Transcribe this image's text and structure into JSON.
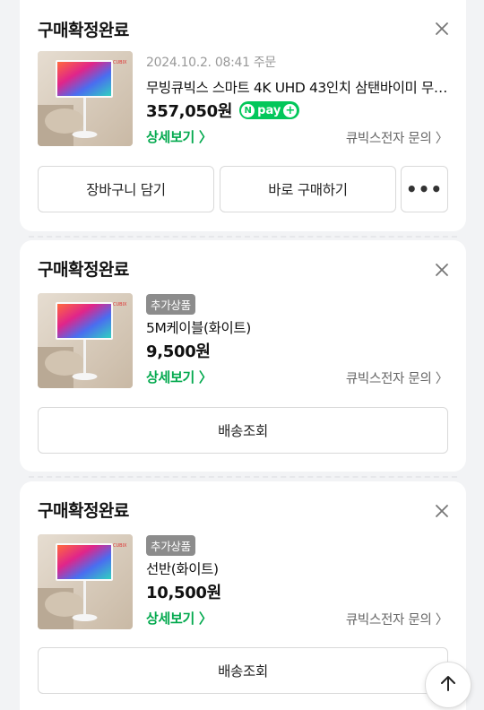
{
  "orders": [
    {
      "status": "구매확정완료",
      "date": "2024.10.2. 08:41 주문",
      "product_name": "무빙큐빅스 스마트 4K UHD 43인치 삼탠바이미 무빙스탠드",
      "price": "357,050원",
      "npay_label": "pay",
      "detail_link": "상세보기 〉",
      "seller_link": "큐빅스전자 문의 〉",
      "buttons": {
        "cart": "장바구니 담기",
        "buy": "바로 구매하기",
        "more": "•••"
      }
    },
    {
      "status": "구매확정완료",
      "badge": "추가상품",
      "product_name": "5M케이블(화이트)",
      "price": "9,500원",
      "detail_link": "상세보기 〉",
      "seller_link": "큐빅스전자 문의 〉",
      "buttons": {
        "track": "배송조회"
      }
    },
    {
      "status": "구매확정완료",
      "badge": "추가상품",
      "product_name": "선반(화이트)",
      "price": "10,500원",
      "detail_link": "상세보기 〉",
      "seller_link": "큐빅스전자 문의 〉",
      "buttons": {
        "track": "배송조회"
      }
    }
  ],
  "icons": {
    "close": "close-icon",
    "scroll_top": "arrow-up-icon"
  },
  "colors": {
    "accent_green": "#03a94e",
    "npay_green": "#03c75a"
  }
}
